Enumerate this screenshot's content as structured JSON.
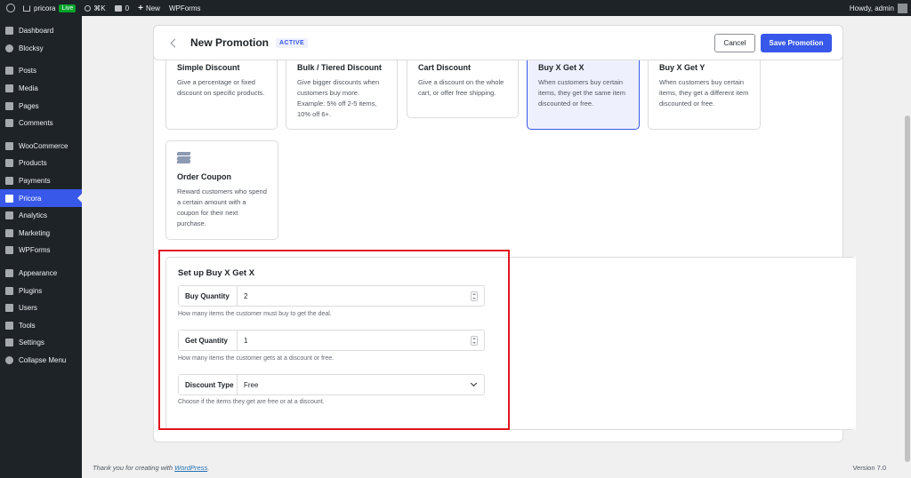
{
  "adminbar": {
    "site_name": "pricora",
    "live_badge": "Live",
    "shortcut": "⌘K",
    "comments_count": "0",
    "new_label": "New",
    "wpforms_label": "WPForms",
    "howdy": "Howdy, admin"
  },
  "sidebar": {
    "items": [
      {
        "label": "Dashboard",
        "icon": "dashboard-icon"
      },
      {
        "label": "Blocksy",
        "icon": "blocksy-icon"
      },
      {
        "label": "Posts",
        "icon": "pin-icon"
      },
      {
        "label": "Media",
        "icon": "media-icon"
      },
      {
        "label": "Pages",
        "icon": "page-icon"
      },
      {
        "label": "Comments",
        "icon": "comment-icon"
      },
      {
        "label": "WooCommerce",
        "icon": "woo-icon"
      },
      {
        "label": "Products",
        "icon": "archive-icon"
      },
      {
        "label": "Payments",
        "icon": "card-icon"
      },
      {
        "label": "Pricora",
        "icon": "pricora-icon"
      },
      {
        "label": "Analytics",
        "icon": "chart-bar-icon"
      },
      {
        "label": "Marketing",
        "icon": "megaphone-icon"
      },
      {
        "label": "WPForms",
        "icon": "form-icon"
      },
      {
        "label": "Appearance",
        "icon": "brush-icon"
      },
      {
        "label": "Plugins",
        "icon": "plug-icon"
      },
      {
        "label": "Users",
        "icon": "user-icon"
      },
      {
        "label": "Tools",
        "icon": "wrench-icon"
      },
      {
        "label": "Settings",
        "icon": "settings-icon"
      },
      {
        "label": "Collapse Menu",
        "icon": "collapse-icon"
      }
    ]
  },
  "header": {
    "title": "New Promotion",
    "status_badge": "ACTIVE",
    "cancel_label": "Cancel",
    "save_label": "Save Promotion"
  },
  "promo_types": [
    {
      "title": "Simple Discount",
      "desc": "Give a percentage or fixed discount on specific products."
    },
    {
      "title": "Bulk / Tiered Discount",
      "desc": "Give bigger discounts when customers buy more. Example: 5% off 2-5 items, 10% off 6+."
    },
    {
      "title": "Cart Discount",
      "desc": "Give a discount on the whole cart, or offer free shipping."
    },
    {
      "title": "Buy X Get X",
      "desc": "When customers buy certain items, they get the same item discounted or free."
    },
    {
      "title": "Buy X Get Y",
      "desc": "When customers buy certain items, they get a different item discounted or free."
    },
    {
      "title": "Order Coupon",
      "desc": "Reward customers who spend a certain amount with a coupon for their next purchase."
    }
  ],
  "setup": {
    "title": "Set up Buy X Get X",
    "buy_quantity": {
      "label": "Buy Quantity",
      "value": "2",
      "help": "How many items the customer must buy to get the deal."
    },
    "get_quantity": {
      "label": "Get Quantity",
      "value": "1",
      "help": "How many items the customer gets at a discount or free."
    },
    "discount_type": {
      "label": "Discount Type",
      "value": "Free",
      "help": "Choose if the items they get are free or at a discount."
    }
  },
  "footer": {
    "thanks_prefix": "Thank you for creating with ",
    "thanks_link": "WordPress",
    "thanks_suffix": ".",
    "version": "Version 7.0"
  },
  "colors": {
    "accent": "#3858e9",
    "highlight_box": "#e0161f",
    "admin_dark": "#1d2327"
  }
}
